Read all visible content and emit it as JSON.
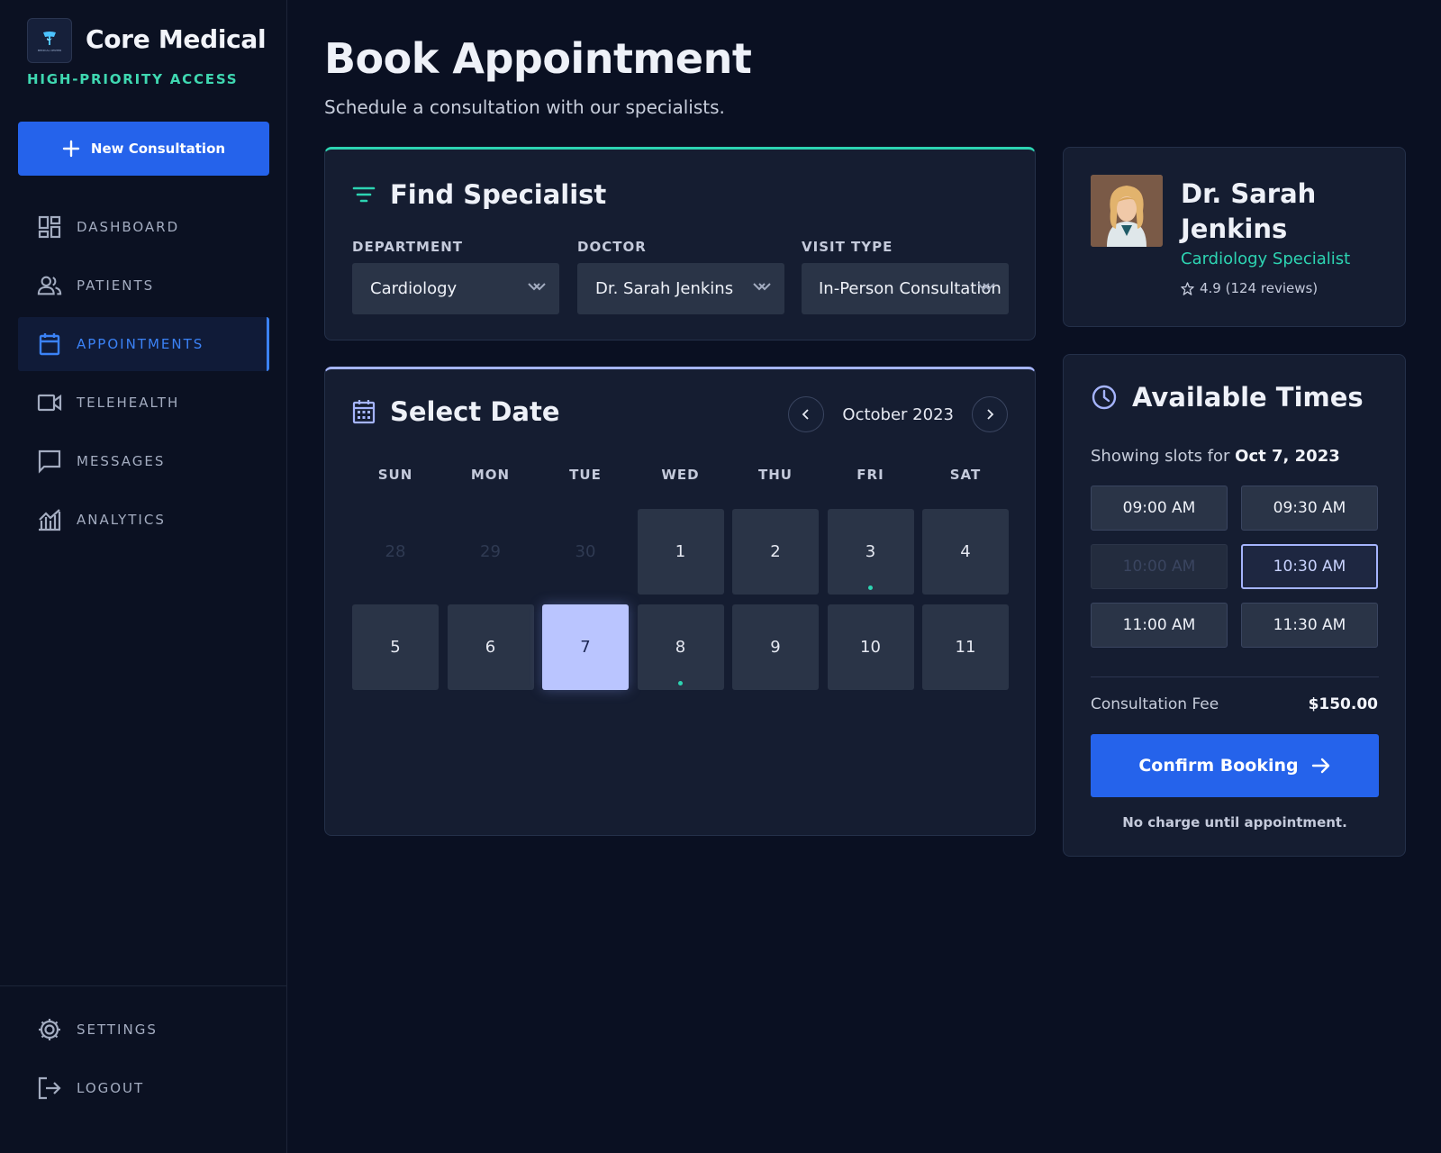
{
  "brand": {
    "name": "Core Medical",
    "tagline": "HIGH-PRIORITY ACCESS",
    "logo_text": "MEDICAL CENTER"
  },
  "sidebar": {
    "new_button": "New Consultation",
    "items": [
      {
        "label": "DASHBOARD",
        "icon": "dashboard-icon"
      },
      {
        "label": "PATIENTS",
        "icon": "people-icon"
      },
      {
        "label": "APPOINTMENTS",
        "icon": "calendar-icon",
        "active": true
      },
      {
        "label": "TELEHEALTH",
        "icon": "video-icon"
      },
      {
        "label": "MESSAGES",
        "icon": "chat-icon"
      },
      {
        "label": "ANALYTICS",
        "icon": "chart-icon"
      }
    ],
    "bottom": [
      {
        "label": "SETTINGS",
        "icon": "gear-icon"
      },
      {
        "label": "LOGOUT",
        "icon": "logout-icon"
      }
    ]
  },
  "page": {
    "title": "Book Appointment",
    "subtitle": "Schedule a consultation with our specialists."
  },
  "find": {
    "title": "Find Specialist",
    "department": {
      "label": "DEPARTMENT",
      "value": "Cardiology"
    },
    "doctor": {
      "label": "DOCTOR",
      "value": "Dr. Sarah Jenkins"
    },
    "visit_type": {
      "label": "VISIT TYPE",
      "value": "In-Person Consultation"
    }
  },
  "calendar": {
    "title": "Select Date",
    "month": "October 2023",
    "weekdays": [
      "SUN",
      "MON",
      "TUE",
      "WED",
      "THU",
      "FRI",
      "SAT"
    ],
    "days": [
      "28",
      "29",
      "30",
      "1",
      "2",
      "3",
      "4",
      "5",
      "6",
      "7",
      "8",
      "9",
      "10",
      "11"
    ],
    "muted_days": [
      "28",
      "29",
      "30"
    ],
    "selected_day": "7",
    "dot_days": [
      "3",
      "8"
    ]
  },
  "doctor_card": {
    "name": "Dr. Sarah Jenkins",
    "specialty": "Cardiology Specialist",
    "rating": "4.9 (124 reviews)"
  },
  "times": {
    "title": "Available Times",
    "showing_prefix": "Showing slots for",
    "showing_date": "Oct 7, 2023",
    "slots": [
      {
        "label": "09:00 AM",
        "state": "available"
      },
      {
        "label": "09:30 AM",
        "state": "available"
      },
      {
        "label": "10:00 AM",
        "state": "disabled"
      },
      {
        "label": "10:30 AM",
        "state": "selected"
      },
      {
        "label": "11:00 AM",
        "state": "available"
      },
      {
        "label": "11:30 AM",
        "state": "available"
      }
    ],
    "fee_label": "Consultation Fee",
    "fee_value": "$150.00",
    "confirm_label": "Confirm Booking",
    "note": "No charge until appointment."
  },
  "colors": {
    "accent_blue": "#2563eb",
    "accent_teal": "#2dd4b2",
    "selected_day": "#bac5ff",
    "background": "#0a1022",
    "card": "#151d31"
  }
}
